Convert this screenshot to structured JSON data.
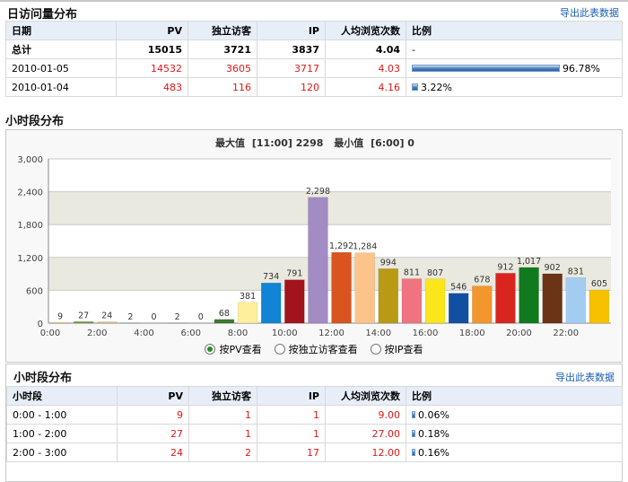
{
  "daily": {
    "title": "日访问量分布",
    "export_label": "导出此表数据",
    "columns": [
      "日期",
      "PV",
      "独立访客",
      "IP",
      "人均浏览次数",
      "比例"
    ],
    "total": {
      "label": "总计",
      "pv": "15015",
      "uv": "3721",
      "ip": "3837",
      "avg": "4.04",
      "ratio": "-"
    },
    "rows": [
      {
        "date": "2010-01-05",
        "pv": "14532",
        "uv": "3605",
        "ip": "3717",
        "avg": "4.03",
        "ratio_text": "96.78%",
        "ratio": 0.9678
      },
      {
        "date": "2010-01-04",
        "pv": "483",
        "uv": "116",
        "ip": "120",
        "avg": "4.16",
        "ratio_text": "3.22%",
        "ratio": 0.0322
      }
    ]
  },
  "hourly_chart": {
    "section_title": "小时段分布",
    "header_max_label": "最大值",
    "header_max_value": "[11:00]  2298",
    "header_min_label": "最小值",
    "header_min_value": "[6:00]  0",
    "radios": [
      {
        "label": "按PV查看",
        "selected": true
      },
      {
        "label": "按独立访客查看",
        "selected": false
      },
      {
        "label": "按IP查看",
        "selected": false
      }
    ]
  },
  "chart_data": {
    "type": "bar",
    "categories": [
      "0:00",
      "1:00",
      "2:00",
      "3:00",
      "4:00",
      "5:00",
      "6:00",
      "7:00",
      "8:00",
      "9:00",
      "10:00",
      "11:00",
      "12:00",
      "13:00",
      "14:00",
      "15:00",
      "16:00",
      "17:00",
      "18:00",
      "19:00",
      "20:00",
      "21:00",
      "22:00",
      "23:00"
    ],
    "x_tick_labels": [
      "0:00",
      "2:00",
      "4:00",
      "6:00",
      "8:00",
      "10:00",
      "12:00",
      "14:00",
      "16:00",
      "18:00",
      "20:00",
      "22:00"
    ],
    "values": [
      9,
      27,
      24,
      2,
      0,
      2,
      0,
      68,
      381,
      734,
      791,
      2298,
      1292,
      1284,
      994,
      811,
      807,
      546,
      678,
      912,
      1017,
      902,
      831,
      605
    ],
    "value_labels": [
      "9",
      "27",
      "24",
      "2",
      "0",
      "2",
      "0",
      "68",
      "381",
      "734",
      "791",
      "2,298",
      "1,292",
      "1,284",
      "994",
      "811",
      "807",
      "546",
      "678",
      "912",
      "1,017",
      "902",
      "831",
      "605"
    ],
    "colors": [
      "#f5a623",
      "#6a9a3a",
      "#d9c38a",
      "#8a8a8a",
      "#8a8a8a",
      "#7f7f7f",
      "#7f7f7f",
      "#3c7a30",
      "#fdef9b",
      "#1184d6",
      "#a3131d",
      "#a38bc4",
      "#d9541e",
      "#fcc48a",
      "#b99a14",
      "#f07380",
      "#fbe51b",
      "#114fa0",
      "#f3962d",
      "#d8261f",
      "#117a1e",
      "#6b3417",
      "#a3cdf0",
      "#f7c100"
    ],
    "yticks": [
      0,
      600,
      1200,
      1800,
      2400,
      3000
    ],
    "ytick_labels": [
      "0",
      "600",
      "1,200",
      "1,800",
      "2,400",
      "3,000"
    ],
    "ylim": [
      0,
      3000
    ],
    "grid": true
  },
  "hourly_table": {
    "title": "小时段分布",
    "export_label": "导出此表数据",
    "columns": [
      "小时段",
      "PV",
      "独立访客",
      "IP",
      "人均浏览次数",
      "比例"
    ],
    "rows": [
      {
        "period": "0:00 - 1:00",
        "pv": "9",
        "uv": "1",
        "ip": "1",
        "avg": "9.00",
        "ratio_text": "0.06%",
        "ratio": 0.0006
      },
      {
        "period": "1:00 - 2:00",
        "pv": "27",
        "uv": "1",
        "ip": "1",
        "avg": "27.00",
        "ratio_text": "0.18%",
        "ratio": 0.0018
      },
      {
        "period": "2:00 - 3:00",
        "pv": "24",
        "uv": "2",
        "ip": "17",
        "avg": "12.00",
        "ratio_text": "0.16%",
        "ratio": 0.0016
      }
    ]
  }
}
